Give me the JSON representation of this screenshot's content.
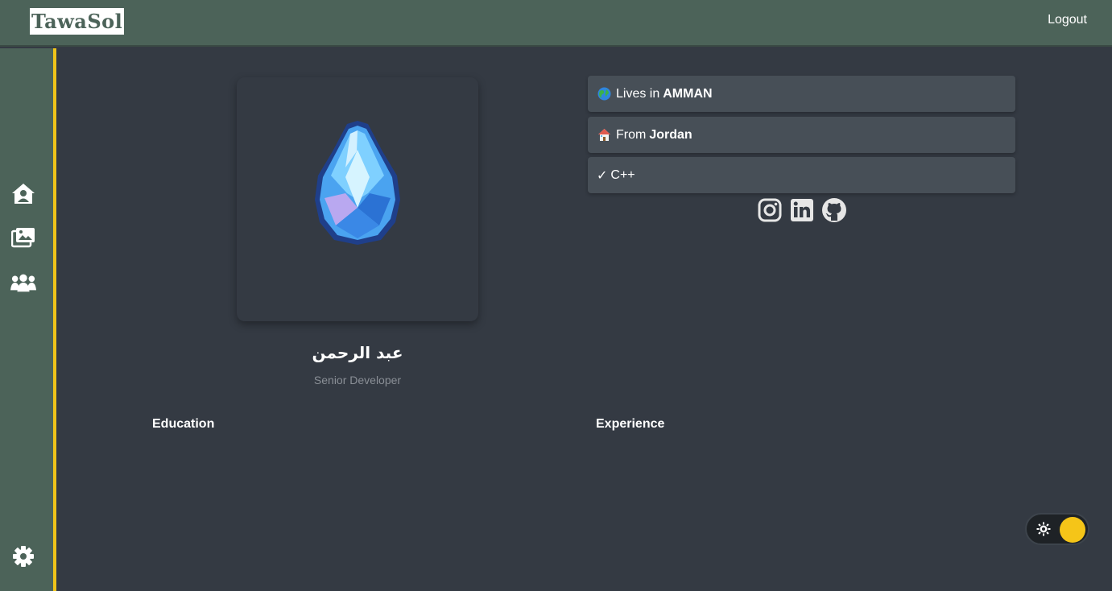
{
  "header": {
    "logo_text": "TawaSol",
    "logout_label": "Logout"
  },
  "sidebar": {
    "items": [
      {
        "icon": "home-user-icon"
      },
      {
        "icon": "photos-icon"
      },
      {
        "icon": "users-group-icon"
      }
    ],
    "settings_icon": "gear-icon",
    "accent_color": "#f0c419"
  },
  "profile": {
    "name": "عبد الرحمن",
    "title": "Senior Developer",
    "avatar_icon": "crystal-icon"
  },
  "info": {
    "location_prefix": "Lives in",
    "location_value": "AMMAN",
    "country_prefix": "From",
    "country_value": "Jordan",
    "skill_mark": "✓",
    "skill": "C++"
  },
  "socials": [
    "instagram-icon",
    "linkedin-icon",
    "github-icon"
  ],
  "sections": {
    "education": "Education",
    "experience": "Experience"
  },
  "theme_toggle": {
    "icon": "sun-icon",
    "knob_color": "#f5c518"
  },
  "colors": {
    "header_bg": "#4c6359",
    "page_bg": "#343a43",
    "card_bg": "#474f57"
  }
}
